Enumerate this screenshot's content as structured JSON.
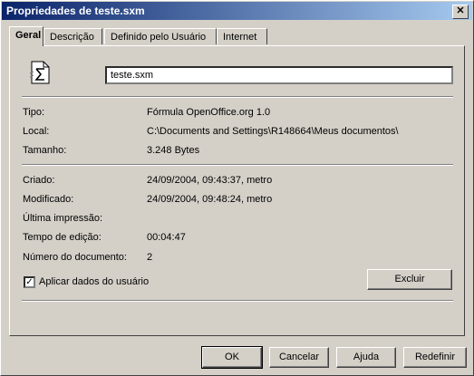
{
  "window": {
    "title": "Propriedades de teste.sxm",
    "close_glyph": "✕"
  },
  "tabs": [
    {
      "label": "Geral",
      "active": true
    },
    {
      "label": "Descrição"
    },
    {
      "label": "Definido pelo Usuário"
    },
    {
      "label": "Internet"
    }
  ],
  "general": {
    "filename_value": "teste.sxm",
    "type_label": "Tipo:",
    "type_value": "Fórmula OpenOffice.org 1.0",
    "location_label": "Local:",
    "location_value": "C:\\Documents and Settings\\R148664\\Meus documentos\\",
    "size_label": "Tamanho:",
    "size_value": "3.248 Bytes",
    "created_label": "Criado:",
    "created_value": "24/09/2004, 09:43:37, metro",
    "modified_label": "Modificado:",
    "modified_value": "24/09/2004, 09:48:24, metro",
    "printed_label": "Última impressão:",
    "printed_value": "",
    "edit_time_label": "Tempo de edição:",
    "edit_time_value": "00:04:47",
    "doc_number_label": "Número do documento:",
    "doc_number_value": "2",
    "apply_user_data_label": "Aplicar dados do usuário",
    "apply_user_data_checked": true,
    "delete_label": "Excluir"
  },
  "footer": {
    "ok": "OK",
    "cancel": "Cancelar",
    "help": "Ajuda",
    "reset": "Redefinir"
  },
  "icons": {
    "document": "formula-document-icon",
    "check_glyph": "✓"
  },
  "colors": {
    "face": "#d4d0c8",
    "title_start": "#0a246a",
    "title_end": "#a6caf0"
  }
}
